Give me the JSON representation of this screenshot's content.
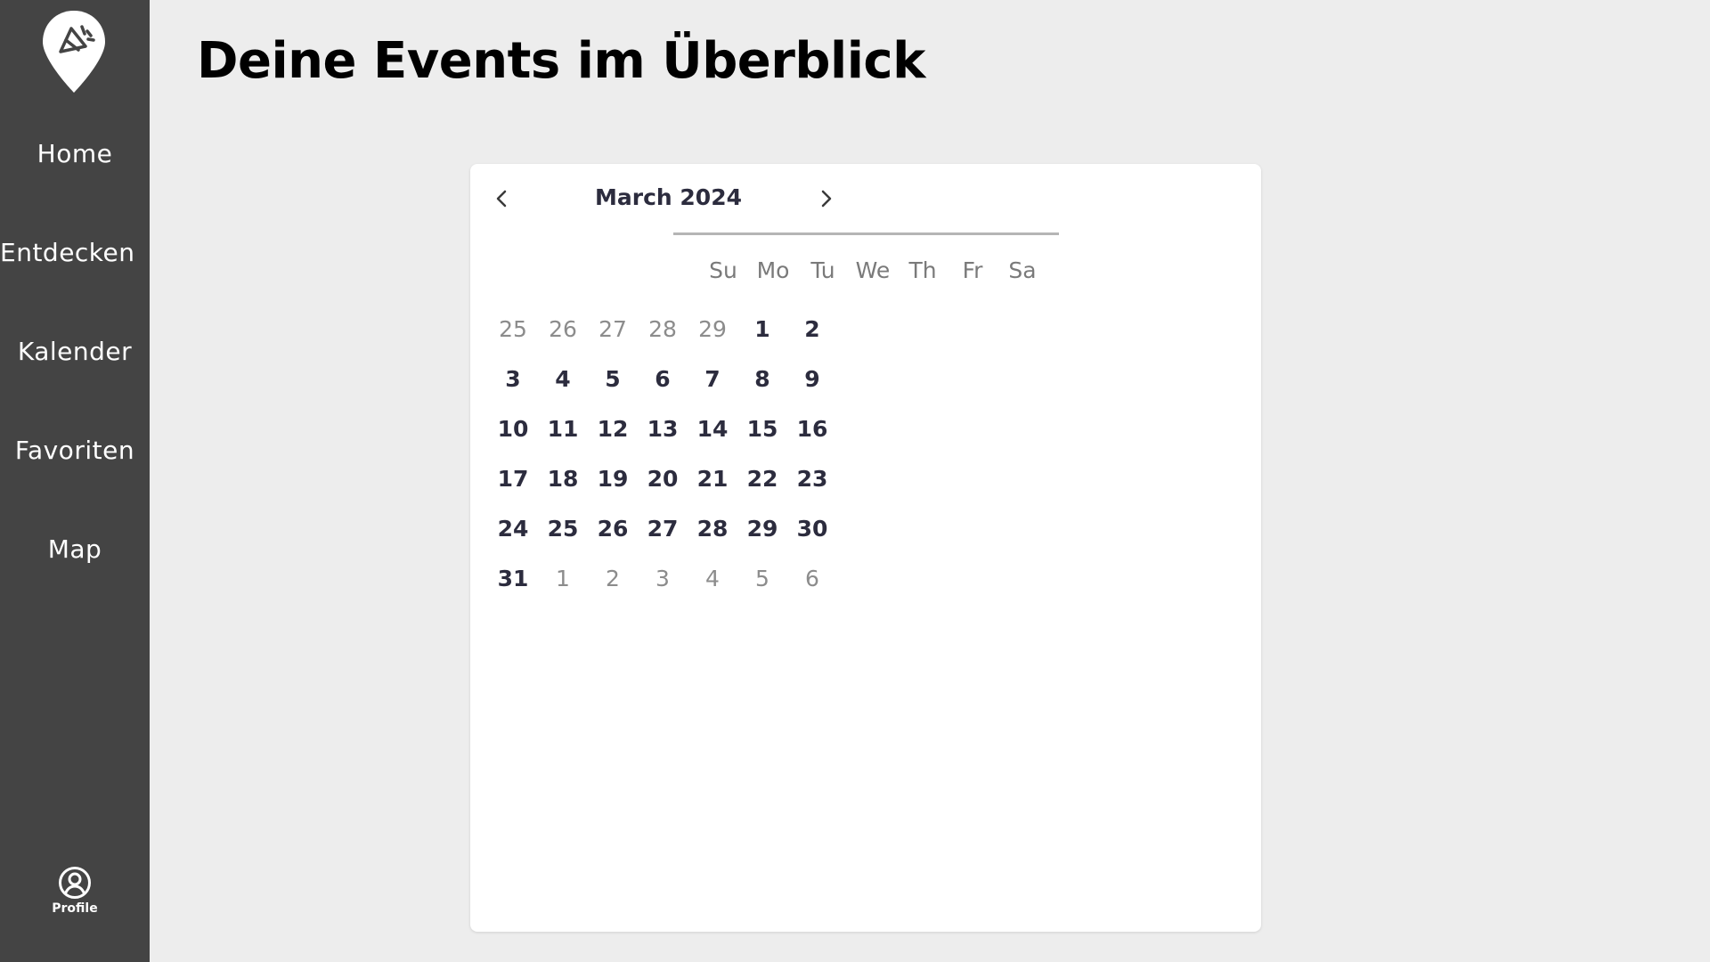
{
  "app": {
    "title": "Deine Events im Überblick"
  },
  "sidebar": {
    "logo_icon": "map-pin-party-popper-icon",
    "items": [
      {
        "label": "Home"
      },
      {
        "label": "Entdecken"
      },
      {
        "label": "Kalender"
      },
      {
        "label": "Favoriten"
      },
      {
        "label": "Map"
      }
    ],
    "profile": {
      "label": "Profile",
      "icon": "user-circle-icon"
    }
  },
  "calendar": {
    "month_label": "March 2024",
    "prev_icon": "chevron-left-icon",
    "next_icon": "chevron-right-icon",
    "weekdays": [
      "Su",
      "Mo",
      "Tu",
      "We",
      "Th",
      "Fr",
      "Sa"
    ],
    "weeks": [
      [
        {
          "d": "25",
          "out": true
        },
        {
          "d": "26",
          "out": true
        },
        {
          "d": "27",
          "out": true
        },
        {
          "d": "28",
          "out": true
        },
        {
          "d": "29",
          "out": true
        },
        {
          "d": "1",
          "out": false
        },
        {
          "d": "2",
          "out": false
        }
      ],
      [
        {
          "d": "3",
          "out": false
        },
        {
          "d": "4",
          "out": false
        },
        {
          "d": "5",
          "out": false
        },
        {
          "d": "6",
          "out": false
        },
        {
          "d": "7",
          "out": false
        },
        {
          "d": "8",
          "out": false
        },
        {
          "d": "9",
          "out": false
        }
      ],
      [
        {
          "d": "10",
          "out": false
        },
        {
          "d": "11",
          "out": false
        },
        {
          "d": "12",
          "out": false
        },
        {
          "d": "13",
          "out": false
        },
        {
          "d": "14",
          "out": false
        },
        {
          "d": "15",
          "out": false
        },
        {
          "d": "16",
          "out": false
        }
      ],
      [
        {
          "d": "17",
          "out": false
        },
        {
          "d": "18",
          "out": false
        },
        {
          "d": "19",
          "out": false
        },
        {
          "d": "20",
          "out": false
        },
        {
          "d": "21",
          "out": false
        },
        {
          "d": "22",
          "out": false
        },
        {
          "d": "23",
          "out": false
        }
      ],
      [
        {
          "d": "24",
          "out": false
        },
        {
          "d": "25",
          "out": false
        },
        {
          "d": "26",
          "out": false
        },
        {
          "d": "27",
          "out": false
        },
        {
          "d": "28",
          "out": false
        },
        {
          "d": "29",
          "out": false
        },
        {
          "d": "30",
          "out": false
        }
      ],
      [
        {
          "d": "31",
          "out": false
        },
        {
          "d": "1",
          "out": true
        },
        {
          "d": "2",
          "out": true
        },
        {
          "d": "3",
          "out": true
        },
        {
          "d": "4",
          "out": true
        },
        {
          "d": "5",
          "out": true
        },
        {
          "d": "6",
          "out": true
        }
      ]
    ]
  },
  "colors": {
    "sidebar_bg": "#444444",
    "page_bg": "#ededed",
    "card_bg": "#ffffff",
    "day_text": "#2c2c3e",
    "muted_text": "#8c8c8c"
  }
}
